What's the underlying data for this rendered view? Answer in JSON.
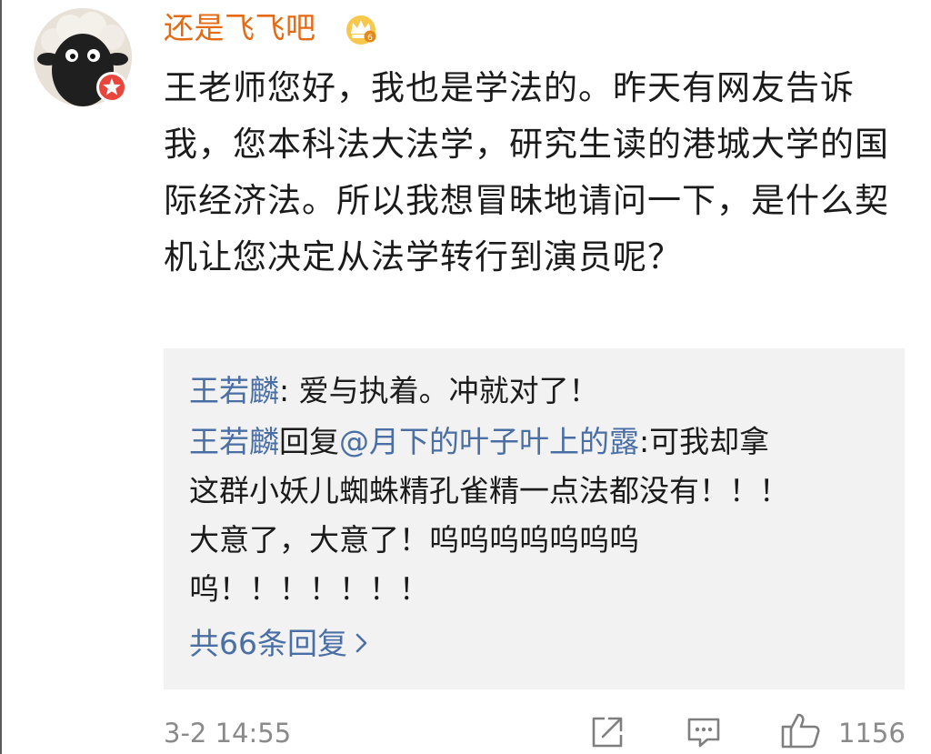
{
  "user": {
    "name": "还是飞飞吧",
    "avatar_icon": "shaun-sheep-avatar",
    "badge_icon": "verified-star-badge-icon",
    "crown_icon": "vip-crown-icon"
  },
  "post": {
    "text": "王老师您好，我也是学法的。昨天有网友告诉我，您本科法大法学，研究生读的港城大学的国际经济法。所以我想冒昧地请问一下，是什么契机让您决定从法学转行到演员呢？"
  },
  "replies": [
    {
      "author": "王若麟",
      "separator": ": ",
      "text": "爱与执着。冲就对了！"
    },
    {
      "author": "王若麟",
      "reply_word": "回复",
      "mention": "@月下的叶子叶上的露",
      "separator": ":",
      "text": "可我却拿这群小妖儿蜘蛛精孔雀精一点法都没有！！！大意了，大意了！呜呜呜呜呜呜呜呜！！！！！！！"
    }
  ],
  "more_replies": "共66条回复",
  "footer": {
    "time": "3-2 14:55",
    "like_count": "1156"
  },
  "colors": {
    "username": "#e46a14",
    "link": "#4a6fa5",
    "meta": "#8a8a8a",
    "reply_bg": "#f2f2f2"
  }
}
